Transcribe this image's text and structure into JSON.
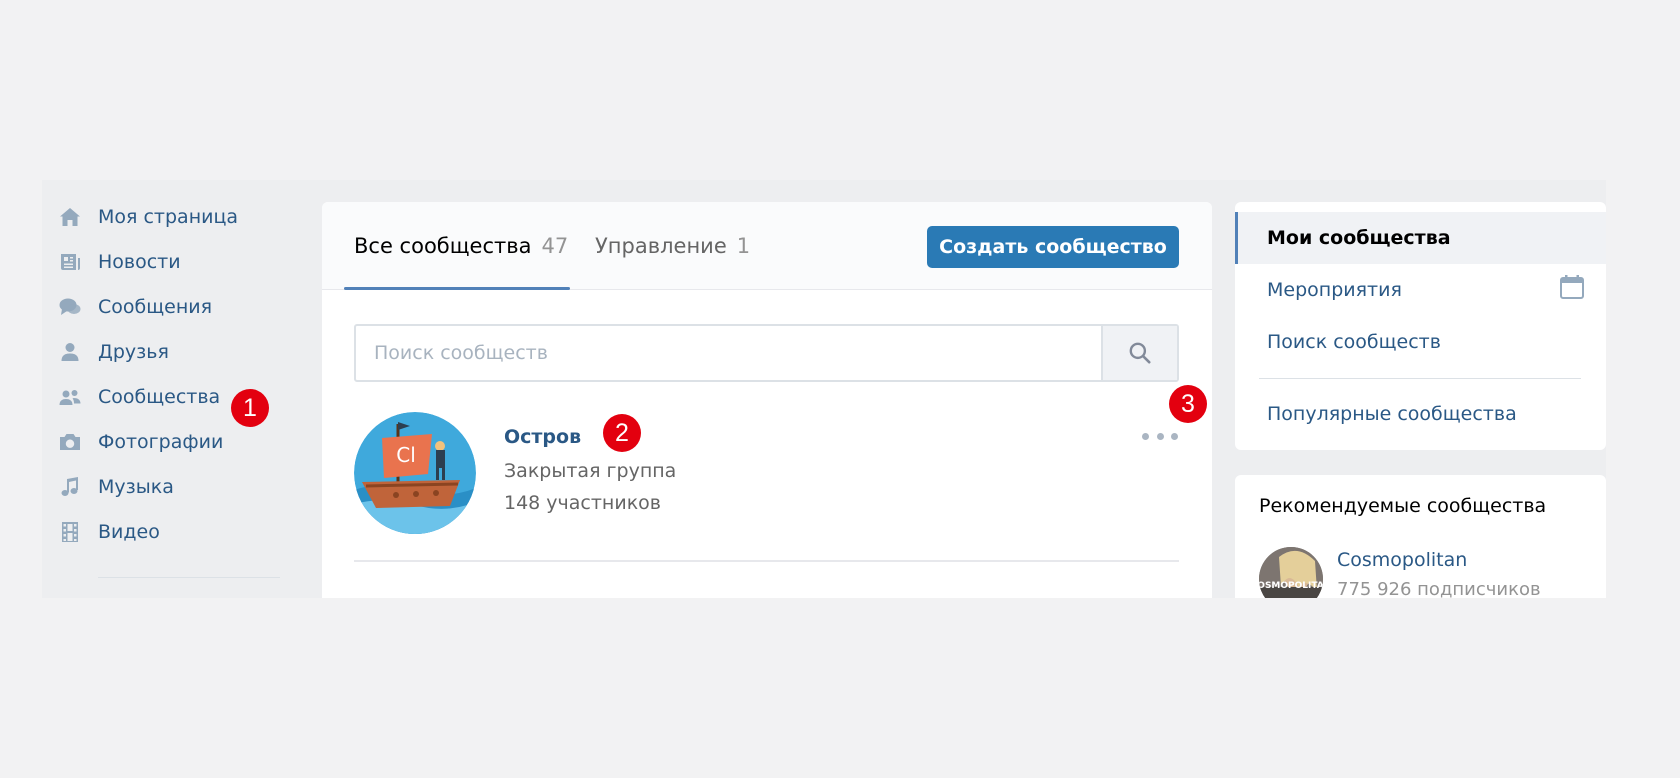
{
  "nav": {
    "items": [
      {
        "label": "Моя страница",
        "icon": "home-icon"
      },
      {
        "label": "Новости",
        "icon": "news-icon"
      },
      {
        "label": "Сообщения",
        "icon": "messages-icon"
      },
      {
        "label": "Друзья",
        "icon": "friend-icon"
      },
      {
        "label": "Сообщества",
        "icon": "communities-icon"
      },
      {
        "label": "Фотографии",
        "icon": "camera-icon"
      },
      {
        "label": "Музыка",
        "icon": "music-note-icon"
      },
      {
        "label": "Видео",
        "icon": "film-icon"
      }
    ]
  },
  "main": {
    "tabs": [
      {
        "label": "Все сообщества",
        "count": "47",
        "active": true
      },
      {
        "label": "Управление",
        "count": "1",
        "active": false
      }
    ],
    "create_button": "Создать сообщество",
    "search": {
      "placeholder": "Поиск сообществ",
      "value": ""
    },
    "group": {
      "name": "Остров",
      "type": "Закрытая группа",
      "members": "148 участников"
    }
  },
  "side_menu": {
    "items": [
      {
        "label": "Мои сообщества",
        "active": true
      },
      {
        "label": "Мероприятия",
        "active": false,
        "icon": "calendar-icon"
      },
      {
        "label": "Поиск сообществ",
        "active": false
      },
      {
        "label": "Популярные сообщества",
        "active": false
      }
    ]
  },
  "recommended": {
    "title": "Рекомендуемые сообщества",
    "items": [
      {
        "name": "Cosmopolitan",
        "subscribers": "775 926 подписчиков",
        "avatar_text": "COSMOPOLITAN"
      }
    ]
  },
  "markers": [
    "1",
    "2",
    "3"
  ],
  "colors": {
    "accent": "#5181b8",
    "button": "#2a7ab5",
    "link": "#2a5885",
    "marker": "#e3000f",
    "background": "#edeef0"
  }
}
